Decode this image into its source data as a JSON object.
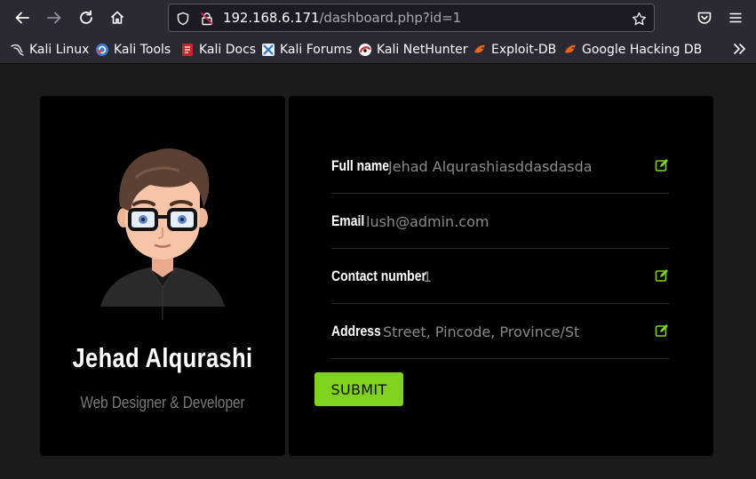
{
  "browser": {
    "url_host": "192.168.6.171",
    "url_path": "/dashboard.php?id=1",
    "bookmarks": [
      {
        "label": "Kali Linux",
        "icon": "kali-dragon-icon"
      },
      {
        "label": "Kali Tools",
        "icon": "kali-tools-icon"
      },
      {
        "label": "Kali Docs",
        "icon": "kali-docs-icon"
      },
      {
        "label": "Kali Forums",
        "icon": "kali-forums-icon"
      },
      {
        "label": "Kali NetHunter",
        "icon": "nethunter-icon"
      },
      {
        "label": "Exploit-DB",
        "icon": "exploit-db-icon"
      },
      {
        "label": "Google Hacking DB",
        "icon": "ghdb-icon"
      }
    ]
  },
  "profile": {
    "name": "Jehad Alqurashi",
    "role": "Web Designer & Developer"
  },
  "form": {
    "fields": [
      {
        "label": "Full name",
        "value": "Jehad Alqurashiasddasdasda",
        "editable": true
      },
      {
        "label": "Email",
        "value": "lush@admin.com",
        "editable": false
      },
      {
        "label": "Contact number",
        "value": "1",
        "editable": true
      },
      {
        "label": "Address",
        "value": "",
        "placeholder": "Street, Pincode, Province/State",
        "editable": true
      }
    ],
    "submit_label": "SUBMIT"
  },
  "colors": {
    "accent": "#7ed321",
    "card": "#000000",
    "page_bg": "#1b1b1b",
    "chrome_bg": "#2b2a33"
  }
}
